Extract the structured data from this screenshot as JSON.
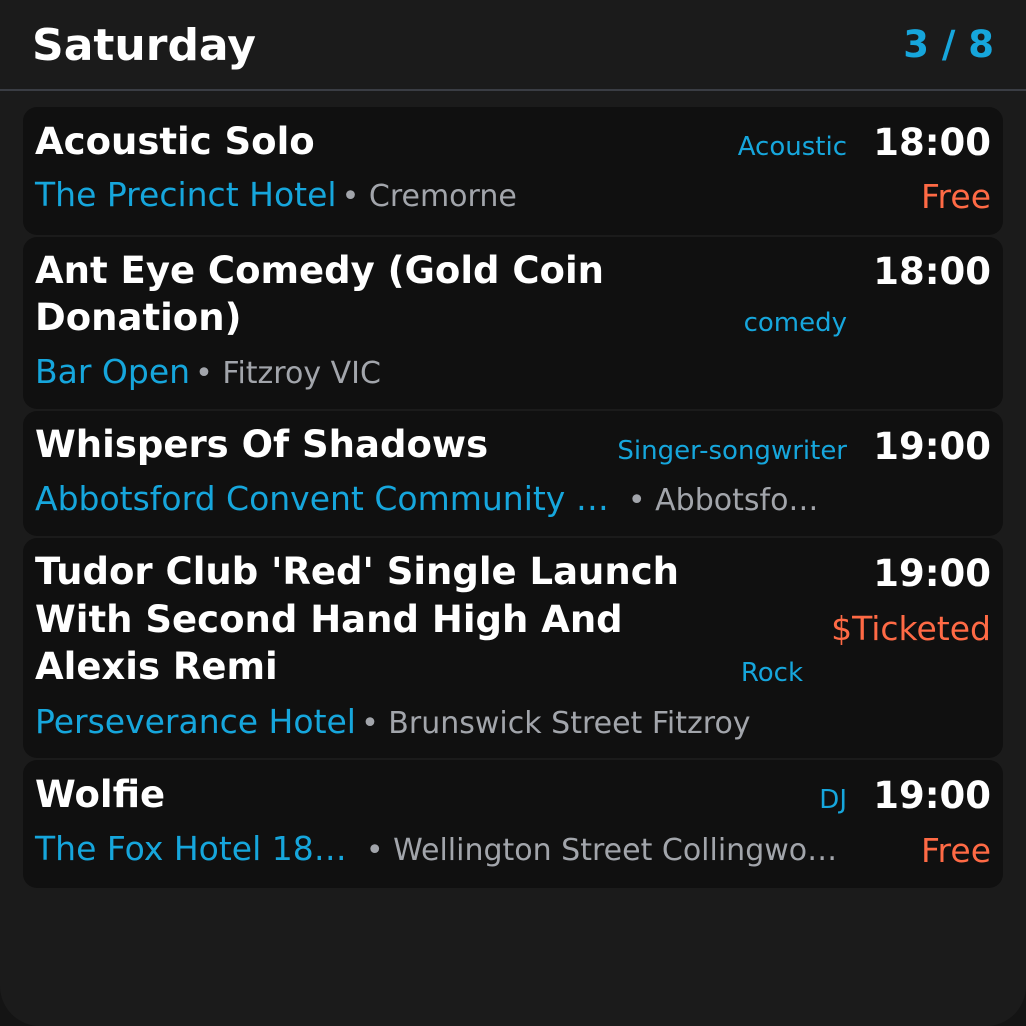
{
  "header": {
    "day": "Saturday",
    "pager": "3 / 8"
  },
  "colors": {
    "background": "#1b1b1b",
    "card": "#101010",
    "accent": "#16a6dc",
    "price": "#ff6a45",
    "muted": "#a2a5ab"
  },
  "events": [
    {
      "title": "Acoustic Solo",
      "genre": "Acoustic",
      "time": "18:00",
      "price": "Free",
      "venue": "The Precinct Hotel",
      "location": "• Cremorne"
    },
    {
      "title_line1": "Ant Eye Comedy (Gold Coin",
      "title_line2": "Donation)",
      "genre": "comedy",
      "time": "18:00",
      "venue": "Bar Open",
      "location": "• Fitzroy VIC"
    },
    {
      "title": "Whispers Of Shadows",
      "genre": "Singer-songwriter",
      "time": "19:00",
      "venue": "Abbotsford Convent Community …",
      "location": "• Abbotsfo…"
    },
    {
      "title_line1": "Tudor Club 'Red' Single Launch",
      "title_line2": "With Second Hand High And",
      "title_line3": "Alexis Remi",
      "genre": "Rock",
      "time": "19:00",
      "price": "$Ticketed",
      "venue": "Perseverance Hotel",
      "location": "• Brunswick Street Fitzroy"
    },
    {
      "title": "Wolfie",
      "genre": "DJ",
      "time": "19:00",
      "price": "Free",
      "venue": "The Fox Hotel 18…",
      "location": "• Wellington Street Collingwo…"
    }
  ]
}
